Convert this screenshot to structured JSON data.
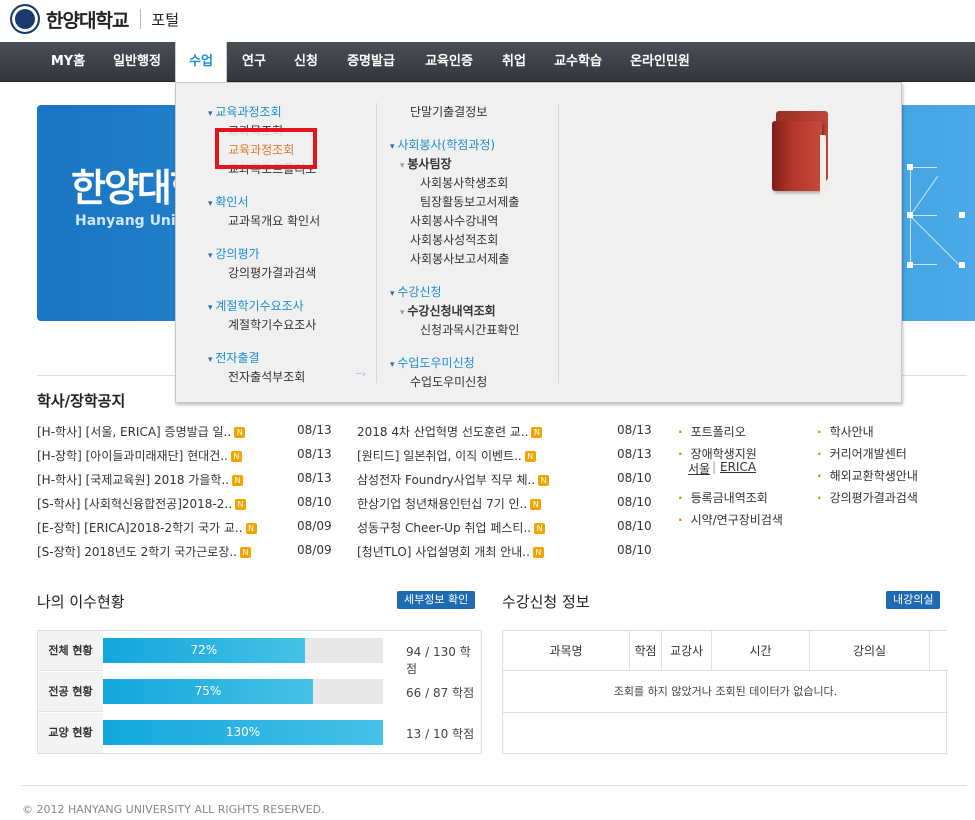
{
  "header": {
    "logo_text": "한양대학교",
    "portal_label": "포털"
  },
  "nav": {
    "items": [
      {
        "label": "MY홈"
      },
      {
        "label": "일반행정"
      },
      {
        "label": "수업"
      },
      {
        "label": "연구"
      },
      {
        "label": "신청"
      },
      {
        "label": "증명발급"
      },
      {
        "label": "교육인증"
      },
      {
        "label": "취업"
      },
      {
        "label": "교수학습"
      },
      {
        "label": "온라인민원"
      }
    ],
    "active": "수업"
  },
  "banner": {
    "title": "한양대학",
    "subtitle": "Hanyang Univ"
  },
  "dropdown": {
    "col1": {
      "cat1": "교육과정조회",
      "cat1_items": [
        "교과목조회",
        "교육과정조회",
        "교과목포트폴리오"
      ],
      "cat2": "확인서",
      "cat2_items": [
        "교과목개요 확인서"
      ],
      "cat3": "강의평가",
      "cat3_items": [
        "강의평가결과검색"
      ],
      "cat4": "계절학기수요조사",
      "cat4_items": [
        "계절학기수요조사"
      ],
      "cat5": "전자출결",
      "cat5_items": [
        "전자출석부조회"
      ]
    },
    "col2": {
      "top_item": "단말기출결정보",
      "cat1": "사회봉사(학점과정)",
      "cat1_group": "봉사팀장",
      "cat1_group_items": [
        "사회봉사학생조회",
        "팀장활동보고서제출"
      ],
      "cat1_items": [
        "사회봉사수강내역",
        "사회봉사성적조회",
        "사회봉사보고서제출"
      ],
      "cat2": "수강신청",
      "cat2_group": "수강신청내역조회",
      "cat2_group_items": [
        "신청과목시간표확인"
      ],
      "cat3": "수업도우미신청",
      "cat3_items": [
        "수업도우미신청"
      ]
    },
    "highlighted_item": "교육과정조회"
  },
  "notices": {
    "title": "학사/장학공지",
    "items": [
      {
        "text": "[H-학사] [서울, ERICA] 증명발급 일..",
        "date": "08/13"
      },
      {
        "text": "[H-장학] [아이들과미래재단] 현대건..",
        "date": "08/13"
      },
      {
        "text": "[H-학사] [국제교육원] 2018 가을학..",
        "date": "08/13"
      },
      {
        "text": "[S-학사] [사회혁신융합전공]2018-2..",
        "date": "08/10"
      },
      {
        "text": "[E-장학] [ERICA]2018-2학기 국가 교..",
        "date": "08/09"
      },
      {
        "text": "[S-장학] 2018년도 2학기 국가근로장..",
        "date": "08/09"
      }
    ]
  },
  "jobs": {
    "items": [
      {
        "text": "2018 4차 산업혁명 선도훈련 교..",
        "date": "08/13"
      },
      {
        "text": "[원티드] 일본취업, 이직 이벤트..",
        "date": "08/13"
      },
      {
        "text": "삼성전자 Foundry사업부 직무 체..",
        "date": "08/10"
      },
      {
        "text": "한상기업 청년채용인턴십 7기 인..",
        "date": "08/10"
      },
      {
        "text": "성동구청 Cheer-Up 취업 페스티..",
        "date": "08/10"
      },
      {
        "text": "[청년TLO] 사업설명회 개최 안내..",
        "date": "08/10"
      }
    ]
  },
  "new_badge": "N",
  "quick_links": {
    "col1": [
      "포트폴리오",
      "장애학생지원",
      "등록금내역조회",
      "시약/연구장비검색"
    ],
    "col1_sub": {
      "seoul": "서울",
      "sep": "|",
      "erica": "ERICA"
    },
    "col2": [
      "학사안내",
      "커리어개발센터",
      "해외교환학생안내",
      "강의평가결과검색"
    ]
  },
  "progress": {
    "title": "나의 이수현황",
    "detail_button": "세부정보 확인",
    "rows": [
      {
        "label": "전체 현황",
        "percent_label": "72%",
        "fill": 0.72,
        "value": "94 / 130 학점"
      },
      {
        "label": "전공 현황",
        "percent_label": "75%",
        "fill": 0.75,
        "value": "66 / 87 학점"
      },
      {
        "label": "교양 현황",
        "percent_label": "130%",
        "fill": 1.0,
        "value": "13 / 10 학점"
      }
    ]
  },
  "course": {
    "title": "수강신청 정보",
    "my_lecture_button": "내강의실",
    "headers": [
      "과목명",
      "학점",
      "교강사",
      "시간",
      "강의실"
    ],
    "empty_message": "조회를 하지 않았거나 조회된 데이터가 없습니다."
  },
  "footer": {
    "copyright": "© 2012 HANYANG UNIVERSITY ALL RIGHTS RESERVED."
  },
  "colors": {
    "accent": "#1e8ed1",
    "nav_bg": "#3f4048",
    "highlight": "#e2151e",
    "progress": "#12a7db"
  }
}
